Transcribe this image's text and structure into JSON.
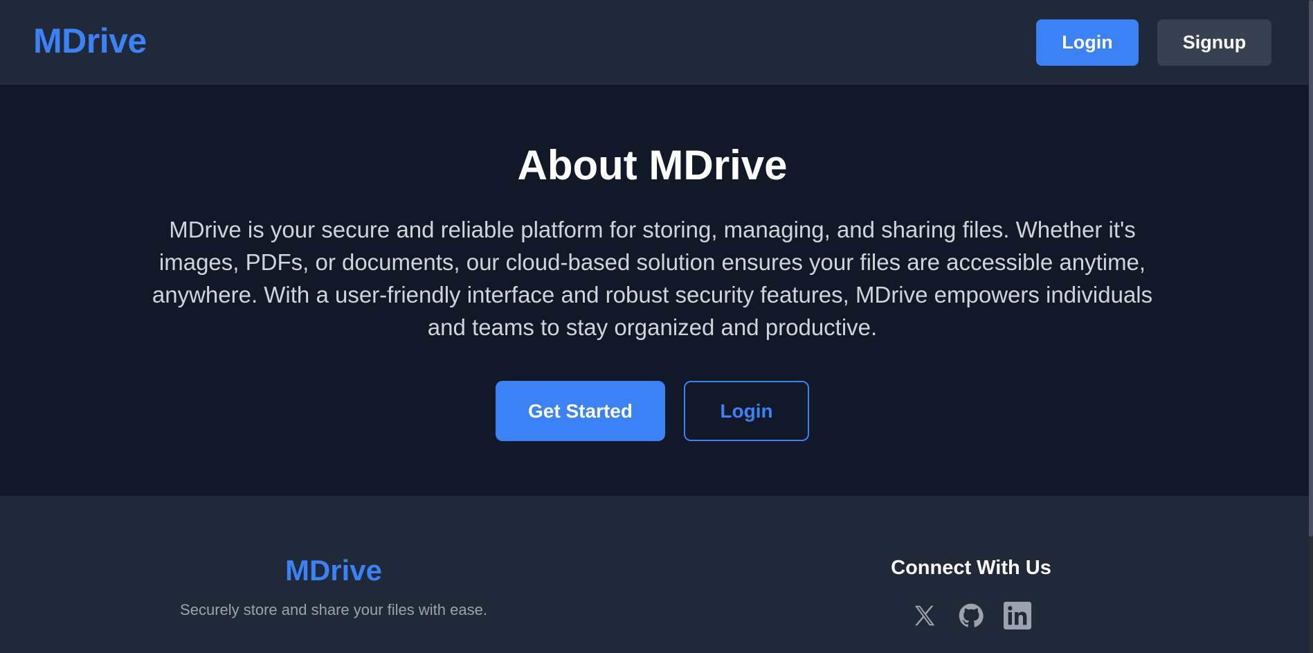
{
  "header": {
    "brand": "MDrive",
    "login_label": "Login",
    "signup_label": "Signup"
  },
  "hero": {
    "title": "About MDrive",
    "description": "MDrive is your secure and reliable platform for storing, managing, and sharing files. Whether it's images, PDFs, or documents, our cloud-based solution ensures your files are accessible anytime, anywhere. With a user-friendly interface and robust security features, MDrive empowers individuals and teams to stay organized and productive.",
    "get_started_label": "Get Started",
    "login_label": "Login"
  },
  "footer": {
    "brand": "MDrive",
    "tagline": "Securely store and share your files with ease.",
    "connect_heading": "Connect With Us",
    "socials": [
      {
        "icon": "x-twitter-icon"
      },
      {
        "icon": "github-icon"
      },
      {
        "icon": "linkedin-icon"
      }
    ]
  },
  "colors": {
    "accent": "#3b82f6",
    "header_bg": "#1f2937",
    "page_bg": "#111827",
    "secondary_button": "#374151",
    "social_icon": "#9ca3af"
  }
}
